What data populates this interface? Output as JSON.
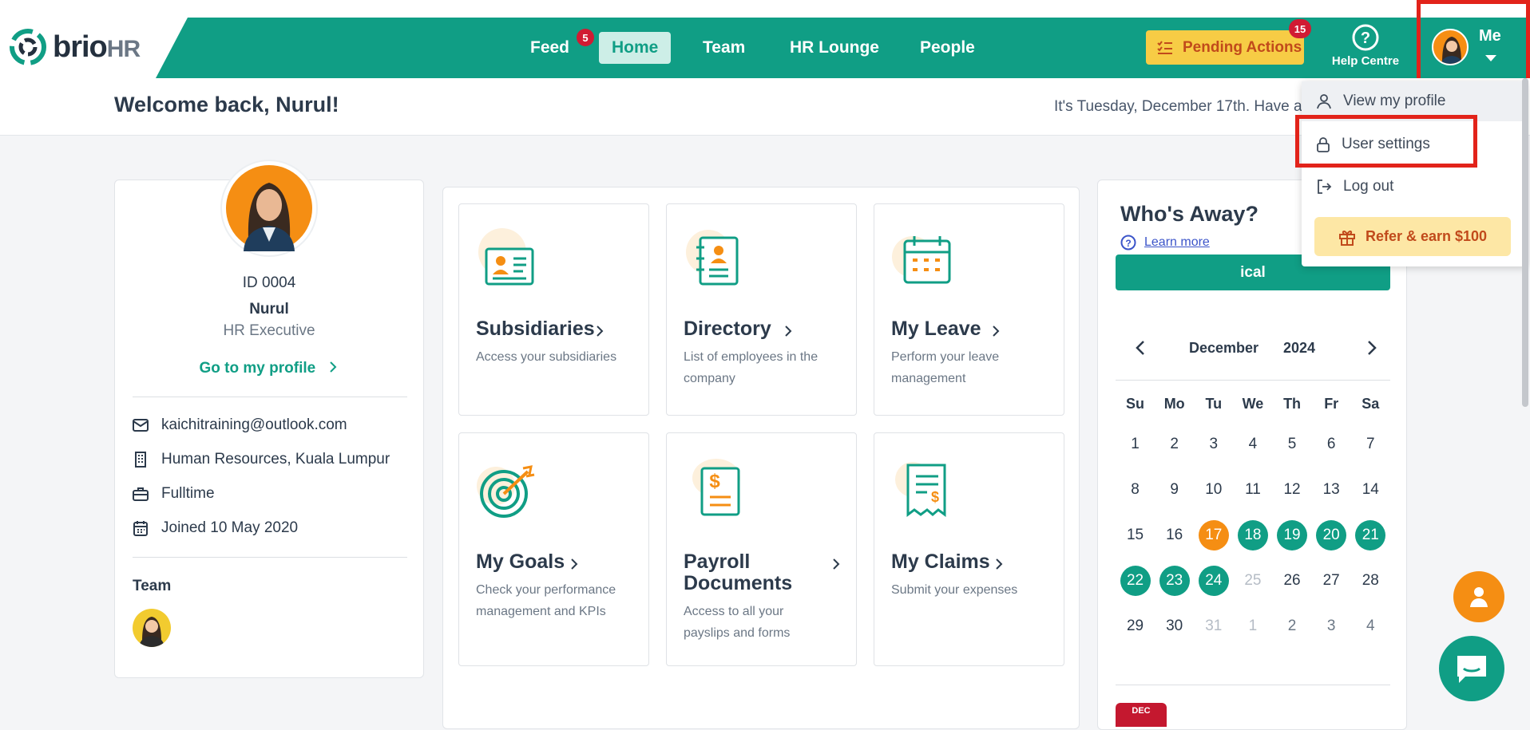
{
  "brand": {
    "word": "brio",
    "suffix": "HR"
  },
  "nav": {
    "feed": "Feed",
    "feed_badge": "5",
    "home": "Home",
    "team": "Team",
    "hr_lounge": "HR Lounge",
    "people": "People"
  },
  "header": {
    "pending": "Pending Actions",
    "pending_badge": "15",
    "help": "Help Centre",
    "me": "Me"
  },
  "welcome": {
    "title": "Welcome back, Nurul!",
    "date": "It's Tuesday, December 17th. Have a"
  },
  "profile": {
    "id": "ID 0004",
    "name": "Nurul",
    "role": "HR Executive",
    "link": "Go to my profile",
    "email": "kaichitraining@outlook.com",
    "dept": "Human Resources, Kuala Lumpur",
    "type": "Fulltime",
    "joined": "Joined 10 May 2020",
    "team_label": "Team"
  },
  "tiles": [
    {
      "title": "Subsidiaries",
      "desc": "Access your subsidiaries"
    },
    {
      "title": "Directory",
      "desc": "List of employees in the company"
    },
    {
      "title": "My Leave",
      "desc": "Perform your leave management"
    },
    {
      "title": "My Goals",
      "desc": "Check your performance management and KPIs"
    },
    {
      "title": "Payroll Documents",
      "desc": "Access to all your payslips and forms"
    },
    {
      "title": "My Claims",
      "desc": "Submit your expenses"
    }
  ],
  "away": {
    "title": "Who's Away?",
    "learn": "Learn more",
    "ical": "ical",
    "month": "December",
    "year": "2024",
    "dow": [
      "Su",
      "Mo",
      "Tu",
      "We",
      "Th",
      "Fr",
      "Sa"
    ],
    "weeks": [
      [
        "1",
        "2",
        "3",
        "4",
        "5",
        "6",
        "7"
      ],
      [
        "8",
        "9",
        "10",
        "11",
        "12",
        "13",
        "14"
      ],
      [
        "15",
        "16",
        "17",
        "18",
        "19",
        "20",
        "21"
      ],
      [
        "22",
        "23",
        "24",
        "25",
        "26",
        "27",
        "28"
      ],
      [
        "29",
        "30",
        "31",
        "1",
        "2",
        "3",
        "4"
      ]
    ],
    "today": "17",
    "away_days": [
      "18",
      "19",
      "20",
      "21",
      "22",
      "23",
      "24"
    ],
    "dec_tag": "DEC"
  },
  "dropdown": {
    "view_profile": "View my profile",
    "user_settings": "User settings",
    "logout": "Log out",
    "refer": "Refer & earn $100"
  },
  "colors": {
    "brand_green": "#109e85",
    "accent_orange": "#f58e13",
    "alert_red": "#d11b33",
    "highlight_box": "#e2231a"
  }
}
